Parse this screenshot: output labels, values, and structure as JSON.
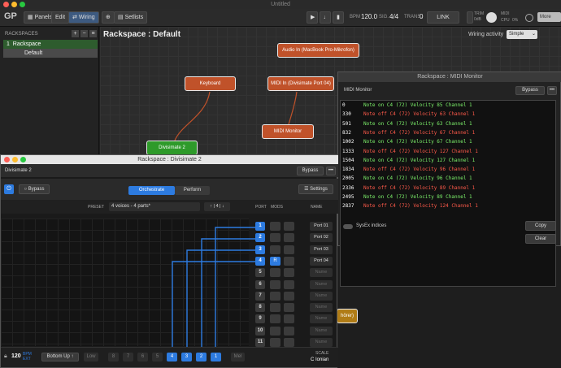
{
  "app": {
    "title": "Untitled"
  },
  "toolbar": {
    "panels": "Panels",
    "edit": "Edit",
    "wiring": "Wiring",
    "setlists": "Setlists",
    "bpm_label": "BPM",
    "bpm_value": "120.0",
    "sig_label": "SIG.",
    "sig_value": "4/4",
    "trans_label": "TRANS.",
    "trans_value": "0",
    "link": "LINK",
    "trim_label": "TRIM",
    "trim_value": "0dB",
    "midi_label": "MIDI",
    "cpu_label": "CPU",
    "cpu_value": "0%",
    "more": "More"
  },
  "rackspaces": {
    "header": "RACKSPACES",
    "add": "+",
    "remove": "−",
    "menu": "≡",
    "items": [
      {
        "index": "1",
        "name": "Rackspace"
      },
      {
        "name": "Default"
      }
    ]
  },
  "wiring": {
    "title": "Rackspace : Default",
    "activity_label": "Wiring activity",
    "activity_value": "Simple",
    "nodes": {
      "audio_in": "Audio In (MacBook Pro-Mikrofon)",
      "keyboard": "Keyboard",
      "midi_in": "MIDI In (Divisimate Port 04)",
      "midi_monitor": "MIDI Monitor",
      "divisimate": "Divisimate 2",
      "partial": "hörer)"
    }
  },
  "midi_monitor": {
    "window_title": "Rackspace : MIDI Monitor",
    "subtitle": "MIDI Monitor",
    "bypass": "Bypass",
    "log": [
      {
        "time": "0",
        "msg": "Note on C4 (72) Velocity 85 Channel 1",
        "kind": "on"
      },
      {
        "time": "330",
        "msg": "Note off C4 (72) Velocity 63 Channel 1",
        "kind": "off"
      },
      {
        "time": "501",
        "msg": "Note on C4 (72) Velocity 63 Channel 1",
        "kind": "on"
      },
      {
        "time": "832",
        "msg": "Note off C4 (72) Velocity 67 Channel 1",
        "kind": "off"
      },
      {
        "time": "1002",
        "msg": "Note on C4 (72) Velocity 67 Channel 1",
        "kind": "on"
      },
      {
        "time": "1333",
        "msg": "Note off C4 (72) Velocity 127 Channel 1",
        "kind": "off"
      },
      {
        "time": "1504",
        "msg": "Note on C4 (72) Velocity 127 Channel 1",
        "kind": "on"
      },
      {
        "time": "1834",
        "msg": "Note off C4 (72) Velocity 96 Channel 1",
        "kind": "off"
      },
      {
        "time": "2005",
        "msg": "Note on C4 (72) Velocity 96 Channel 1",
        "kind": "on"
      },
      {
        "time": "2336",
        "msg": "Note off C4 (72) Velocity 89 Channel 1",
        "kind": "off"
      },
      {
        "time": "2495",
        "msg": "Note on C4 (72) Velocity 89 Channel 1",
        "kind": "on"
      },
      {
        "time": "2837",
        "msg": "Note off C4 (72) Velocity 124 Channel 1",
        "kind": "off"
      }
    ],
    "sysex_label": "SysEx indices",
    "copy": "Copy",
    "clear": "Clear"
  },
  "divisimate": {
    "window_title": "Rackspace : Divisimate 2",
    "plugin_name": "Divisimate 2",
    "bypass_top": "Bypass",
    "bypass": "Bypass",
    "tab_orchestrate": "Orchestrate",
    "tab_perform": "Perform",
    "settings": "Settings",
    "preset_label": "PRESET",
    "preset_value": "4 voices - 4 parts*",
    "preset_nav": "↑ | 4 | ↓",
    "col_port": "PORT",
    "col_mods": "MODS",
    "col_name": "NAME",
    "ports": [
      {
        "num": "1",
        "active": true,
        "mod": "",
        "name": "Port 01"
      },
      {
        "num": "2",
        "active": true,
        "mod": "",
        "name": "Port 02"
      },
      {
        "num": "3",
        "active": true,
        "mod": "",
        "name": "Port 03"
      },
      {
        "num": "4",
        "active": true,
        "mod": "R",
        "name": "Port 04"
      },
      {
        "num": "5",
        "active": false,
        "mod": "",
        "name": "Name"
      },
      {
        "num": "6",
        "active": false,
        "mod": "",
        "name": "Name"
      },
      {
        "num": "7",
        "active": false,
        "mod": "",
        "name": "Name"
      },
      {
        "num": "8",
        "active": false,
        "mod": "",
        "name": "Name"
      },
      {
        "num": "9",
        "active": false,
        "mod": "",
        "name": "Name"
      },
      {
        "num": "10",
        "active": false,
        "mod": "",
        "name": "Name"
      },
      {
        "num": "11",
        "active": false,
        "mod": "",
        "name": "Name"
      }
    ],
    "bottom": {
      "bpm_value": "120",
      "bpm_label": "BPM",
      "bpm_sub": "EXT",
      "mode": "Bottom Up",
      "low": "Low",
      "voices": [
        "8",
        "7",
        "6",
        "5",
        "4",
        "3",
        "2",
        "1"
      ],
      "mel": "Mel",
      "scale_label": "SCALE",
      "scale_value": "C Ionian"
    }
  },
  "colors": {
    "accent_blue": "#2d7be0",
    "node_orange": "#c0522a",
    "node_green": "#2e9a2a",
    "note_on": "#7cf06a",
    "note_off": "#ff5a4a"
  }
}
